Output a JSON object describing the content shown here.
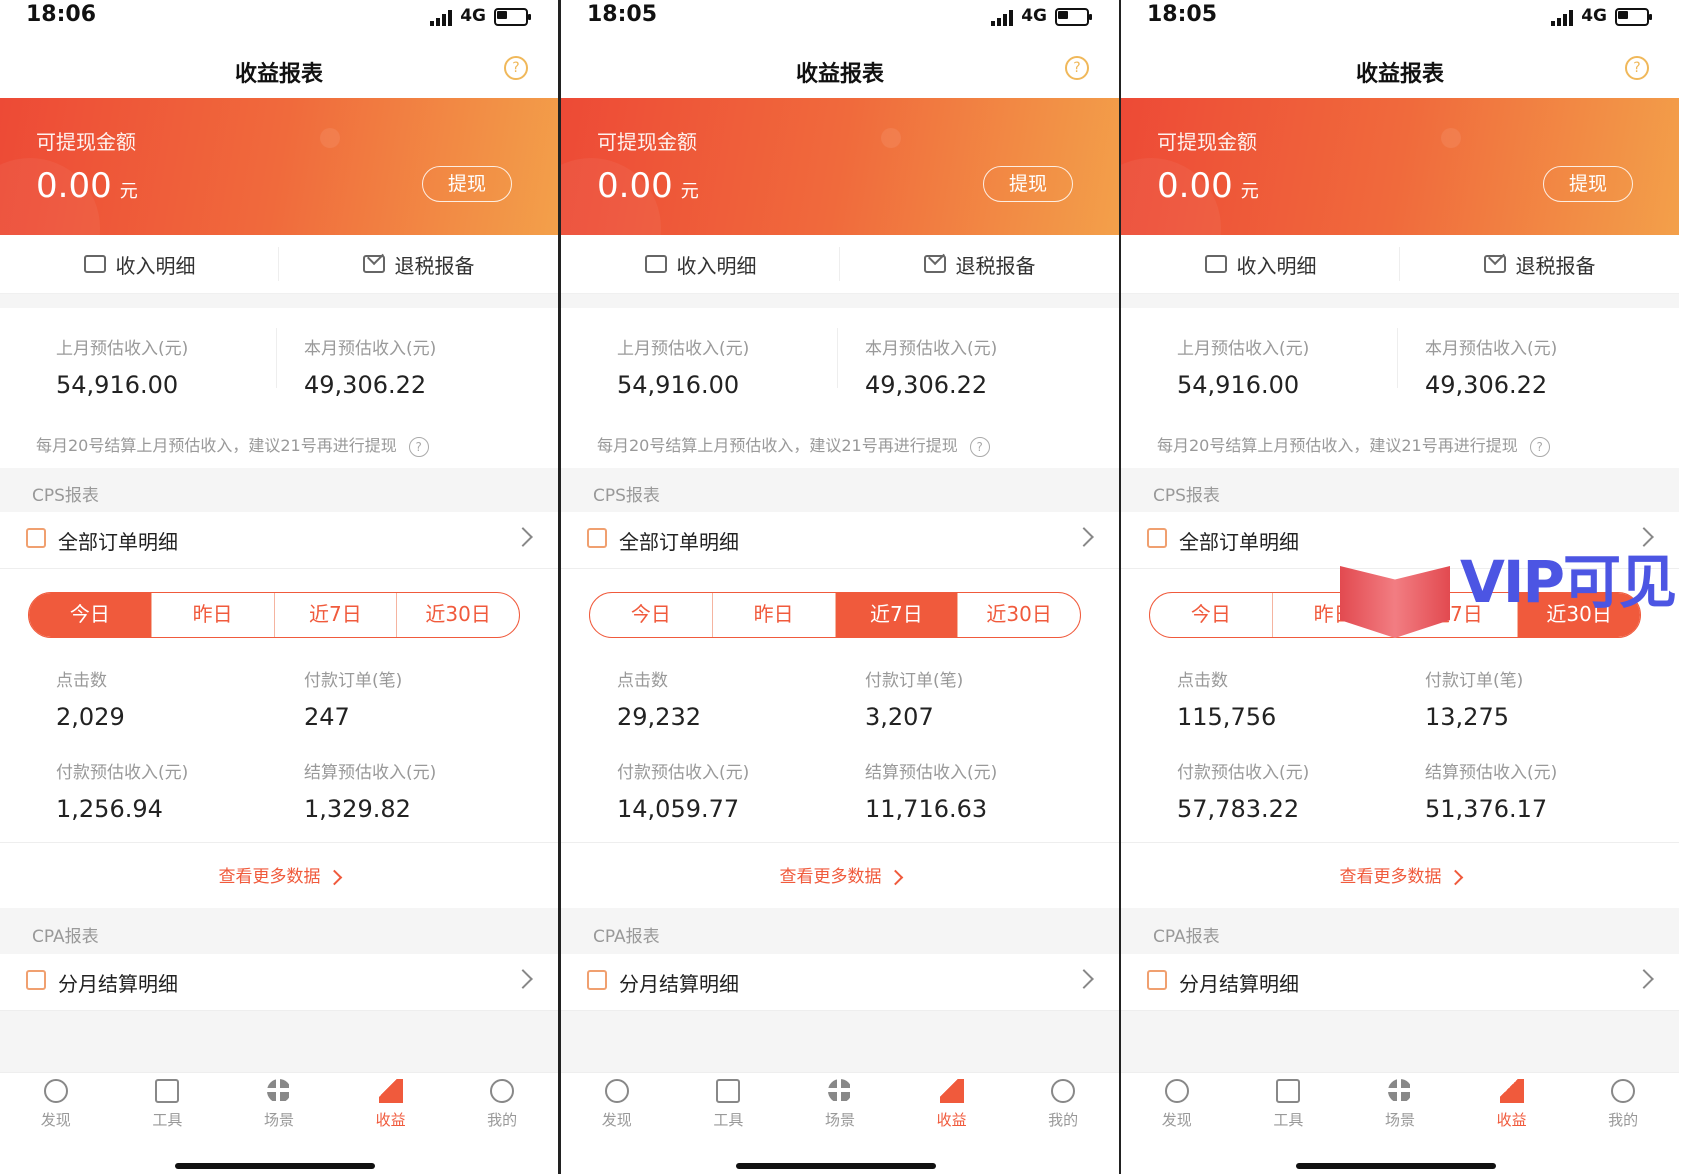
{
  "screens": [
    {
      "status_time": "18:06",
      "network": "4G",
      "nav_title": "收益报表",
      "withdraw_label": "可提现金额",
      "amount": "0.00",
      "unit": "元",
      "withdraw_btn": "提现",
      "quick": [
        "收入明细",
        "退税报备"
      ],
      "last_month_label": "上月预估收入(元)",
      "last_month_val": "54,916.00",
      "this_month_label": "本月预估收入(元)",
      "this_month_val": "49,306.22",
      "note": "每月20号结算上月预估收入，建议21号再进行提现",
      "cps_label": "CPS报表",
      "cps_row": "全部订单明细",
      "segments": [
        "今日",
        "昨日",
        "近7日",
        "近30日"
      ],
      "active_segment": 0,
      "clicks_label": "点击数",
      "clicks": "2,029",
      "orders_label": "付款订单(笔)",
      "orders": "247",
      "pay_est_label": "付款预估收入(元)",
      "pay_est": "1,256.94",
      "settle_est_label": "结算预估收入(元)",
      "settle_est": "1,329.82",
      "more": "查看更多数据",
      "cpa_label": "CPA报表",
      "cpa_row": "分月结算明细",
      "tabs": [
        "发现",
        "工具",
        "场景",
        "收益",
        "我的"
      ],
      "active_tab": 3
    },
    {
      "status_time": "18:05",
      "network": "4G",
      "nav_title": "收益报表",
      "withdraw_label": "可提现金额",
      "amount": "0.00",
      "unit": "元",
      "withdraw_btn": "提现",
      "quick": [
        "收入明细",
        "退税报备"
      ],
      "last_month_label": "上月预估收入(元)",
      "last_month_val": "54,916.00",
      "this_month_label": "本月预估收入(元)",
      "this_month_val": "49,306.22",
      "note": "每月20号结算上月预估收入，建议21号再进行提现",
      "cps_label": "CPS报表",
      "cps_row": "全部订单明细",
      "segments": [
        "今日",
        "昨日",
        "近7日",
        "近30日"
      ],
      "active_segment": 2,
      "clicks_label": "点击数",
      "clicks": "29,232",
      "orders_label": "付款订单(笔)",
      "orders": "3,207",
      "pay_est_label": "付款预估收入(元)",
      "pay_est": "14,059.77",
      "settle_est_label": "结算预估收入(元)",
      "settle_est": "11,716.63",
      "more": "查看更多数据",
      "cpa_label": "CPA报表",
      "cpa_row": "分月结算明细",
      "tabs": [
        "发现",
        "工具",
        "场景",
        "收益",
        "我的"
      ],
      "active_tab": 3
    },
    {
      "status_time": "18:05",
      "network": "4G",
      "nav_title": "收益报表",
      "withdraw_label": "可提现金额",
      "amount": "0.00",
      "unit": "元",
      "withdraw_btn": "提现",
      "quick": [
        "收入明细",
        "退税报备"
      ],
      "last_month_label": "上月预估收入(元)",
      "last_month_val": "54,916.00",
      "this_month_label": "本月预估收入(元)",
      "this_month_val": "49,306.22",
      "note": "每月20号结算上月预估收入，建议21号再进行提现",
      "cps_label": "CPS报表",
      "cps_row": "全部订单明细",
      "segments": [
        "今日",
        "昨日",
        "近7日",
        "近30日"
      ],
      "active_segment": 3,
      "clicks_label": "点击数",
      "clicks": "115,756",
      "orders_label": "付款订单(笔)",
      "orders": "13,275",
      "pay_est_label": "付款预估收入(元)",
      "pay_est": "57,783.22",
      "settle_est_label": "结算预估收入(元)",
      "settle_est": "51,376.17",
      "more": "查看更多数据",
      "cpa_label": "CPA报表",
      "cpa_row": "分月结算明细",
      "tabs": [
        "发现",
        "工具",
        "场景",
        "收益",
        "我的"
      ],
      "active_tab": 3
    }
  ],
  "watermark": "VIP可见",
  "colors": {
    "accent": "#f05a3c",
    "banner_start": "#ed4a36",
    "banner_end": "#f3a04a"
  },
  "tab_icons": [
    "bulb-icon",
    "toolbox-icon",
    "grid-icon",
    "chart-icon",
    "medal-icon"
  ]
}
